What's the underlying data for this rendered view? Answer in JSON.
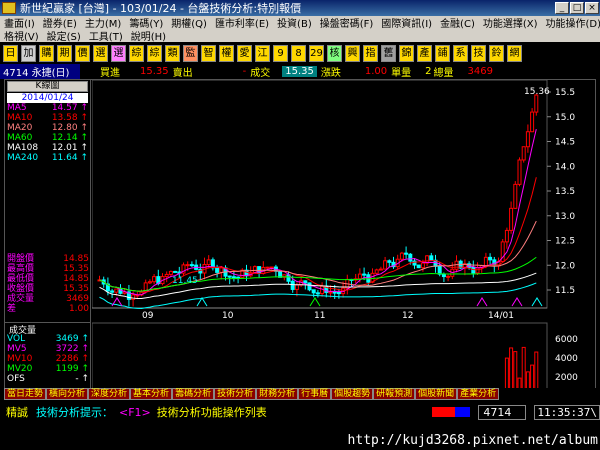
{
  "window": {
    "title": "新世紀贏家 [台灣] - 103/01/24 - 台盤技術分析:特別報價"
  },
  "menu": {
    "row1": [
      "畫面(I)",
      "證券(E)",
      "主力(M)",
      "籌碼(Y)",
      "期權(Q)",
      "匯市利率(E)",
      "投資(B)",
      "操盤密碼(F)",
      "國際資訊(I)",
      "金融(C)",
      "功能選擇(X)",
      "功能操作(D)"
    ],
    "row2": [
      "格視(V)",
      "設定(S)",
      "工具(T)",
      "說明(H)"
    ]
  },
  "toolbar": [
    "日",
    "加",
    "購",
    "期",
    "價",
    "選",
    "選",
    "綜",
    "綜",
    "類",
    "監",
    "智",
    "權",
    "愛",
    "江",
    "9",
    "8",
    "29",
    "核",
    "興",
    "指",
    "舊",
    "錦",
    "產",
    "鋪",
    "系",
    "技",
    "鈴",
    "網"
  ],
  "quote": {
    "code": "4714 永捷(日)",
    "buy_label": "買進",
    "buy_value": "15.35",
    "sell_label": "賣出",
    "sell_value": "-",
    "deal_label": "成交",
    "deal_value": "15.35",
    "change_label": "漲跌",
    "change_value": "1.00",
    "vol_label": "單量",
    "vol_value": "2",
    "total_label": "總量",
    "total_value": "3469"
  },
  "left_panel": {
    "kbox": "K線圖",
    "date": "2014/01/24",
    "ma": [
      {
        "name": "MA5",
        "value": "14.57",
        "color": "#ff00ff"
      },
      {
        "name": "MA10",
        "value": "13.58",
        "color": "#ff0000"
      },
      {
        "name": "MA20",
        "value": "12.80",
        "color": "#ff8080"
      },
      {
        "name": "MA60",
        "value": "12.14",
        "color": "#00ff00"
      },
      {
        "name": "MA108",
        "value": "12.01",
        "color": "#ffffff"
      },
      {
        "name": "MA240",
        "value": "11.64",
        "color": "#00ffff"
      }
    ],
    "ohlc": [
      {
        "name": "開盤價",
        "value": "14.85"
      },
      {
        "name": "最高價",
        "value": "15.35"
      },
      {
        "name": "最低價",
        "value": "14.85"
      },
      {
        "name": "收盤價",
        "value": "15.35"
      },
      {
        "name": "成交量",
        "value": "3469"
      },
      {
        "name": "差",
        "value": "1.00"
      }
    ],
    "vol_title": "成交量",
    "vol": [
      {
        "name": "VOL",
        "value": "3469",
        "color": "#00ffff"
      },
      {
        "name": "MV5",
        "value": "3722",
        "color": "#ff00ff"
      },
      {
        "name": "MV10",
        "value": "2286",
        "color": "#ff0000"
      },
      {
        "name": "MV20",
        "value": "1199",
        "color": "#00ff00"
      },
      {
        "name": "OFS",
        "value": "-",
        "color": "#ffffff"
      }
    ]
  },
  "chart": {
    "y_ticks": [
      "15.5",
      "15.0",
      "14.5",
      "14.0",
      "13.5",
      "13.0",
      "12.5",
      "12.0",
      "11.5"
    ],
    "x_ticks": [
      "09",
      "10",
      "11",
      "12",
      "14/01"
    ],
    "high_label": "15.36",
    "low_label": "11.45",
    "vol_ticks": [
      "6000",
      "4000",
      "2000"
    ]
  },
  "tabs": [
    "當日走勢",
    "橫向分析",
    "深度分析",
    "基本分析",
    "籌碼分析",
    "技術分析",
    "財務分析",
    "行事曆",
    "個股趨勢",
    "研報預測",
    "個股新聞",
    "產業分析"
  ],
  "status": {
    "left": "精誠",
    "hint": "技術分析提示：",
    "key": "<F1>",
    "text": "技術分析功能操作列表",
    "code": "4714",
    "time": "11:35:37\\"
  },
  "url": "http://kujd3268.pixnet.net/album"
}
